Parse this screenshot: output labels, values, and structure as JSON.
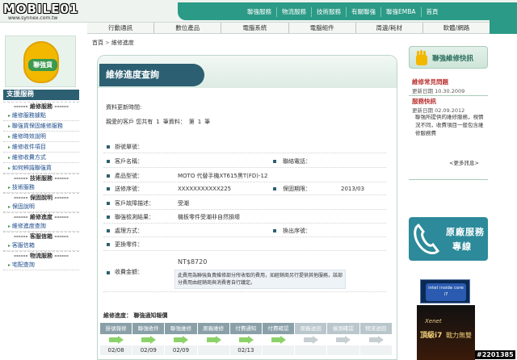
{
  "logo": {
    "text": "MOBILE01",
    "url": "www.synnex.com.tw"
  },
  "top_nav": [
    "聯強服務",
    "物流服務",
    "技術服務",
    "有關聯強",
    "聯強EMBA",
    "首頁"
  ],
  "main_nav": [
    "行動通訊",
    "數位產品",
    "電腦系統",
    "電腦組件",
    "周邊/耗材",
    "軟體/網路"
  ],
  "sidebar": {
    "badge": "聯強貨",
    "title": "支援服務",
    "sections": [
      {
        "heading": "------ 維修服務 ------",
        "links": [
          "維修服務據點",
          "聯強貨保固維修服務",
          "維修時效說明",
          "維修收件項目",
          "維修收費方式",
          "如何辨識聯強貨"
        ]
      },
      {
        "heading": "------ 技術服務 ------",
        "links": [
          "技術服務"
        ]
      },
      {
        "heading": "------ 保固說明 ------",
        "links": [
          "保固說明"
        ]
      },
      {
        "heading": "------ 維修進度 ------",
        "links": [
          "維修進度查詢"
        ]
      },
      {
        "heading": "------ 客服信箱 ------",
        "links": [
          "客服信箱"
        ]
      },
      {
        "heading": "------ 物流服務 ------",
        "links": [
          "宅配查詢"
        ]
      }
    ]
  },
  "breadcrumb": {
    "home": "首頁",
    "sep": ">",
    "current": "維修進度"
  },
  "panel": {
    "title": "維修進度查詢",
    "update_label": "資料更新時間:",
    "summary": [
      "親愛的客戶 您共有",
      "1",
      "筆資料：",
      "第",
      "1",
      "筆"
    ],
    "fields": {
      "ticket": {
        "label": "掛號單號：",
        "value": ""
      },
      "customer": {
        "label": "客戶名稱：",
        "value": ""
      },
      "phone": {
        "label": "聯絡電話：",
        "value": ""
      },
      "model": {
        "label": "產品型號：",
        "value": "MOTO 代替手機XT615黑T(FD)-12"
      },
      "serial": {
        "label": "送修序號：",
        "value": "XXXXXXXXXXX225"
      },
      "warranty": {
        "label": "保固期限：",
        "value": "2013/03"
      },
      "fault": {
        "label": "客戶故障描述：",
        "value": "受潮"
      },
      "result": {
        "label": "聯強檢測結果：",
        "value": "機板零件受潮非自然損壞"
      },
      "handling": {
        "label": "處理方式：",
        "value": ""
      },
      "exchange_serial": {
        "label": "換出序號：",
        "value": ""
      },
      "parts": {
        "label": "更換零件：",
        "value": ""
      }
    },
    "fee": {
      "label": "收費金額：",
      "amount": "NT$8720",
      "note": "此費用為聯強負責維修部分所收取的費用，如經銷商另行提供其他服務，該部分費用由經銷商與消費者自行議定。"
    },
    "progress_title": "維修進度： 聯強通知報價",
    "steps": [
      {
        "name": "掛號報修",
        "date": "02/08",
        "done": true
      },
      {
        "name": "聯強收件",
        "date": "02/09",
        "done": true
      },
      {
        "name": "聯強維修",
        "date": "02/09",
        "done": true
      },
      {
        "name": "原廠維修",
        "date": "",
        "done": true
      },
      {
        "name": "付費通知",
        "date": "02/13",
        "done": true
      },
      {
        "name": "付費確認",
        "date": "",
        "done": true
      },
      {
        "name": "原廠送回",
        "date": "",
        "done": false
      },
      {
        "name": "檢測確認",
        "date": "",
        "done": false
      },
      {
        "name": "物流送回",
        "date": "",
        "done": false
      }
    ]
  },
  "right": {
    "title": "聯強維修快訊",
    "faq": {
      "title": "維修常見問題",
      "date": "更新日期 10.30.2009"
    },
    "news": {
      "title": "服務快訊",
      "date": "更新日期 02.09.2012"
    },
    "desc": "聯強所提供的維修服務，視情況不同，收費項目一般包含維修服務費",
    "more": "<更多訊息>",
    "service_line1": "原廠服務",
    "service_line2": "專線",
    "ad_intel": "intel inside core i7",
    "ad_game_1": "Xenet",
    "ad_game_2": "頂級i7",
    "ad_game_3": "戰力無雙"
  },
  "watermark": "#2201385",
  "colors": {
    "brand": "#2b9a86",
    "dark": "#2c5f72",
    "accent": "#3a9a4e"
  }
}
